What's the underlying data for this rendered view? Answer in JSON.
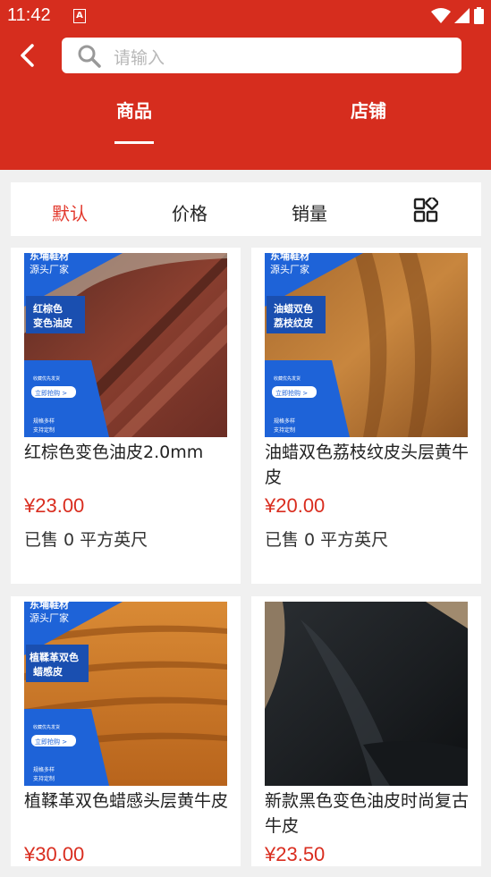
{
  "status_bar": {
    "time": "11:42",
    "notif_letter": "A"
  },
  "search": {
    "placeholder": "请输入"
  },
  "tabs": [
    {
      "label": "商品",
      "active": true
    },
    {
      "label": "店铺",
      "active": false
    }
  ],
  "sort_options": [
    {
      "label": "默认",
      "active": true
    },
    {
      "label": "价格"
    },
    {
      "label": "销量"
    }
  ],
  "view_toggle_icon": "grid-icon",
  "colors": {
    "brand_red": "#d62d1e",
    "price_red": "#d92d1f",
    "active_sort": "#e2382c",
    "banner_blue": "#1e63d8"
  },
  "banner_text": {
    "brand": "东埔鞋材",
    "sub": "源头厂家",
    "slogan": "收藏优先发货",
    "button": "立即抢购 >",
    "footer_1": "规格多样",
    "footer_2": "支持定制"
  },
  "products": [
    {
      "title": "红棕色变色油皮2.0mm",
      "price": "¥23.00",
      "sold": "已售 0 平方英尺",
      "badge": "红棕色\n变色油皮",
      "image": "leather-redbrown"
    },
    {
      "title": "油蜡双色荔枝纹皮头层黄牛皮",
      "price": "¥20.00",
      "sold": "已售 0 平方英尺",
      "badge": "油蜡双色\n荔枝纹皮",
      "image": "leather-tan"
    },
    {
      "title": "植鞣革双色蜡感头层黄牛皮",
      "price": "¥30.00",
      "badge": "植鞣革双色\n蜡感皮",
      "image": "leather-orange"
    },
    {
      "title": "新款黑色变色油皮时尚复古牛皮",
      "price": "¥23.50",
      "image": "leather-black"
    }
  ]
}
